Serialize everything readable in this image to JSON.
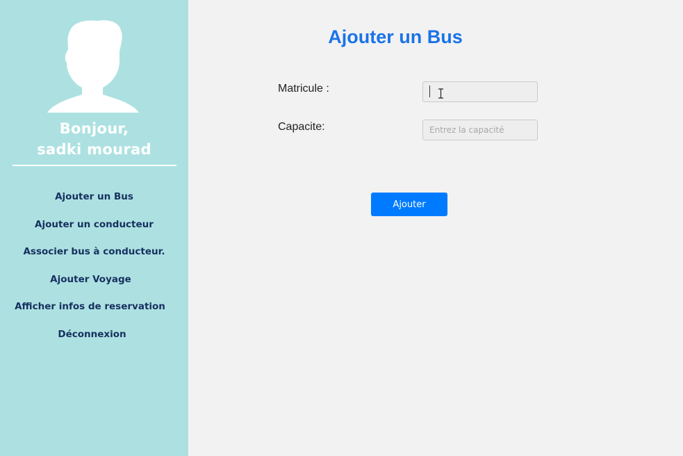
{
  "sidebar": {
    "avatar_icon": "user-silhouette-icon",
    "greeting_line1": "Bonjour,",
    "greeting_line2": "sadki mourad",
    "background_color": "#ade1e1",
    "text_color": "#16305f",
    "items": [
      {
        "label": "Ajouter un Bus"
      },
      {
        "label": "Ajouter un conducteur"
      },
      {
        "label": "Associer bus à conducteur."
      },
      {
        "label": "Ajouter Voyage"
      },
      {
        "label": "Afficher infos de reservation"
      },
      {
        "label": "Déconnexion"
      }
    ]
  },
  "main": {
    "title": "Ajouter un Bus",
    "title_color": "#1a73e8",
    "form": {
      "matricule_label": "Matricule :",
      "matricule_value": "",
      "capacite_label": "Capacite:",
      "capacite_placeholder": "Entrez la capacité",
      "capacite_value": "",
      "submit_label": "Ajouter",
      "submit_color": "#007bff"
    }
  }
}
